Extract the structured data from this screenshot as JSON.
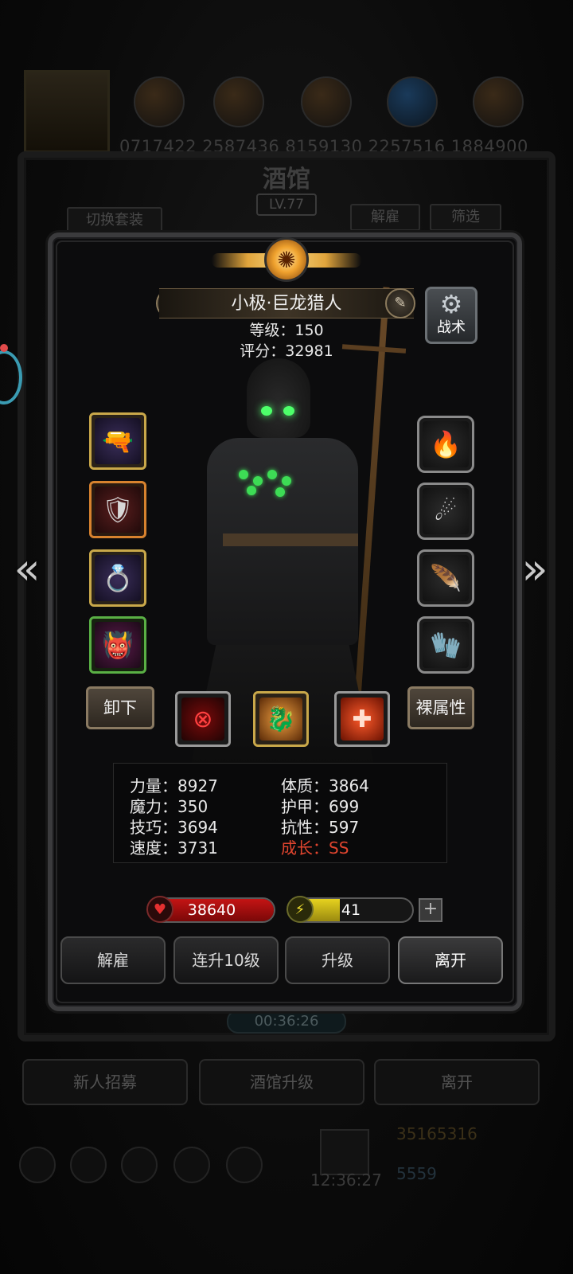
{
  "background": {
    "numbers_text": "0717422 2587436 8159130 2257516 1884900",
    "title": "酒馆",
    "level": "LV.77",
    "tabs": {
      "switch_set": "切换套装",
      "dismiss": "解雇",
      "filter": "筛选"
    },
    "timer": "00:36:26",
    "buttons": {
      "recruit": "新人招募",
      "upgrade_tavern": "酒馆升级",
      "leave": "离开"
    },
    "gold": "35165316",
    "gems": "5559",
    "clock": "12:36:27"
  },
  "hero": {
    "name": "小极·巨龙猎人",
    "level_text": "等级：150",
    "score_text": "评分：32981"
  },
  "tactic_label": "战术",
  "buttons": {
    "unequip": "卸下",
    "bare_stats": "裸属性",
    "dismiss": "解雇",
    "level_up_10": "连升10级",
    "level_up": "升级",
    "leave": "离开"
  },
  "stats": {
    "strength": "力量：8927",
    "constitution": "体质：3864",
    "magic": "魔力：350",
    "armor": "护甲：699",
    "skill": "技巧：3694",
    "resistance": "抗性：597",
    "speed": "速度：3731",
    "growth": "成长：SS"
  },
  "hp": {
    "value": "38640",
    "fill_fraction": 1.0,
    "color": "#c41414"
  },
  "energy": {
    "value": "41",
    "fill_fraction": 0.41,
    "color": "#e6d21f"
  },
  "icons": {
    "left_slots": [
      "pistol-icon",
      "chest-armor-icon",
      "ring-crown-icon",
      "demon-helmet-icon"
    ],
    "right_slots": [
      "fire-relic-icon",
      "flame-orb-icon",
      "feather-quill-icon",
      "gauntlet-icon"
    ],
    "skills": [
      "crosshair-target-icon",
      "dragon-strike-icon",
      "red-cross-heal-icon"
    ]
  }
}
